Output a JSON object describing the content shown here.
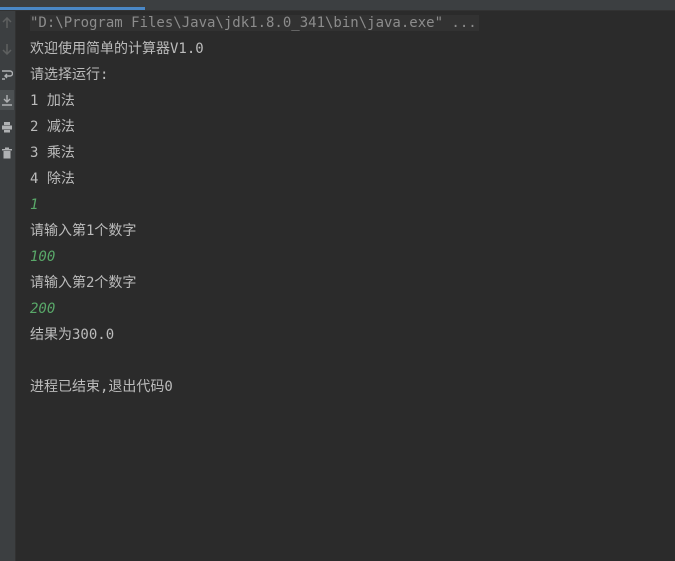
{
  "console": {
    "command": "\"D:\\Program Files\\Java\\jdk1.8.0_341\\bin\\java.exe\" ...",
    "lines": [
      {
        "text": "欢迎使用简单的计算器V1.0",
        "kind": "output"
      },
      {
        "text": "请选择运行:",
        "kind": "output"
      },
      {
        "text": "1 加法",
        "kind": "output"
      },
      {
        "text": "2 减法",
        "kind": "output"
      },
      {
        "text": "3 乘法",
        "kind": "output"
      },
      {
        "text": "4 除法",
        "kind": "output"
      },
      {
        "text": "1",
        "kind": "input"
      },
      {
        "text": "请输入第1个数字",
        "kind": "output"
      },
      {
        "text": "100",
        "kind": "input"
      },
      {
        "text": "请输入第2个数字",
        "kind": "output"
      },
      {
        "text": "200",
        "kind": "input"
      },
      {
        "text": "结果为300.0",
        "kind": "output"
      },
      {
        "text": "",
        "kind": "blank"
      },
      {
        "text": "进程已结束,退出代码0",
        "kind": "output"
      }
    ]
  },
  "toolbar": {
    "buttons": [
      {
        "icon": "arrow-up-icon"
      },
      {
        "icon": "arrow-down-icon"
      },
      {
        "icon": "soft-wrap-icon"
      },
      {
        "icon": "scroll-to-end-icon"
      },
      {
        "icon": "print-icon"
      },
      {
        "icon": "trash-icon"
      }
    ]
  },
  "colors": {
    "background": "#2b2b2b",
    "text": "#bbbbbb",
    "input": "#59a869",
    "command": "#8c8c8c",
    "accent": "#4a88c7"
  }
}
